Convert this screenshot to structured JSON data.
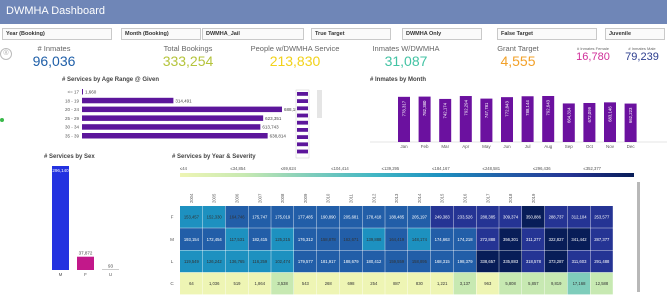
{
  "header": {
    "title": "DWMHA Dashboard"
  },
  "filters": [
    {
      "label": "Year (Booking)"
    },
    {
      "label": "Month (Booking)"
    },
    {
      "label": "DWMHA_Jail"
    },
    {
      "label": "True Target"
    },
    {
      "label": "DWMHA Only"
    },
    {
      "label": "False Target"
    },
    {
      "label": "Juvenile"
    }
  ],
  "kpis": [
    {
      "label": "# Inmates",
      "value": "96,036",
      "color": "#1f5fa8"
    },
    {
      "label": "Total Bookings",
      "value": "333,254",
      "color": "#b5c43c"
    },
    {
      "label": "People w/DWMHA Service",
      "value": "213,830",
      "color": "#f2d21a"
    },
    {
      "label": "Inmates W/DWMHA",
      "value": "31,087",
      "color": "#43c3a4"
    },
    {
      "label": "Grant Target",
      "value": "4,555",
      "color": "#f2a12a"
    },
    {
      "label": "# Inmates Female",
      "value": "16,780",
      "color": "#d02f9a"
    },
    {
      "label": "# Inmates Male",
      "value": "79,239",
      "color": "#2b3c8e"
    }
  ],
  "reg_mark": "®",
  "chart_data": [
    {
      "type": "bar",
      "orientation": "horizontal",
      "title": "# Services by Age Range @ Given",
      "categories": [
        "<= 17",
        "18 - 19",
        "20 - 24",
        "25 - 29",
        "30 - 34",
        "35 - 39"
      ],
      "values": [
        1660,
        314491,
        688185,
        623351,
        613743,
        638814
      ],
      "labels": [
        "1,660",
        "314,491",
        "688,185",
        "623,351",
        "613,743",
        "638,814"
      ],
      "color": "#5c169b"
    },
    {
      "type": "bar",
      "title": "# Inmates by Month",
      "categories": [
        "Jan",
        "Feb",
        "Mar",
        "Apr",
        "May",
        "Jun",
        "Jul",
        "Aug",
        "Sep",
        "Oct",
        "Nov",
        "Dec"
      ],
      "values": [
        778317,
        782380,
        742174,
        792294,
        747781,
        772843,
        788144,
        792643,
        664314,
        672099,
        683146,
        662223
      ],
      "labels": [
        "778,317",
        "782,380",
        "742,174",
        "792,294",
        "747,781",
        "772,843",
        "788,144",
        "792,643",
        "664,314",
        "672,099",
        "683,146",
        "662,223"
      ],
      "color": "#6b119f"
    },
    {
      "type": "bar",
      "title": "# Services by Sex",
      "categories": [
        "M",
        "F",
        "U"
      ],
      "values": [
        296140,
        37872,
        93
      ],
      "labels": [
        "296,140",
        "37,872",
        "93"
      ],
      "colors": [
        "#2332e0",
        "#c2188a",
        "#9a9a9a"
      ]
    },
    {
      "type": "heatmap",
      "title": "# Services by Year & Severity",
      "legend_ticks": [
        "≤44",
        "≤34,854",
        "≤69,624",
        "≤104,414",
        "≤139,295",
        "≤184,167",
        "≤248,581",
        "≤296,436",
        "≤352,377"
      ],
      "years": [
        "2004",
        "2005",
        "2006",
        "2007",
        "2008",
        "2009",
        "2010",
        "2011",
        "2012",
        "2013",
        "2014",
        "2015",
        "2016",
        "2017",
        "2018",
        "2019"
      ],
      "rows": [
        "F",
        "M",
        "L",
        "C"
      ],
      "values": [
        [
          153457,
          152330,
          164746,
          175747,
          175019,
          177485,
          190890,
          205681,
          178418,
          188485,
          205197,
          249383,
          233526,
          288385,
          309374,
          350886,
          288737,
          312104,
          253577,
          112054
        ],
        [
          193154,
          172454,
          117531,
          182415,
          125215,
          176312,
          158878,
          162671,
          139888,
          164419,
          148174,
          174663,
          174218,
          272888,
          356301,
          311277,
          322827,
          341442,
          287377,
          95688
        ],
        [
          119549,
          126242,
          136765,
          116259,
          102474,
          179577,
          181917,
          188679,
          180412,
          159559,
          158895,
          168315,
          198379,
          338657,
          335883,
          318578,
          373287,
          311603,
          291488,
          86873
        ],
        [
          64,
          1036,
          519,
          1864,
          3538,
          543,
          268,
          698,
          254,
          887,
          830,
          1221,
          3137,
          963,
          5808,
          5857,
          9819,
          17168,
          12588,
          6199
        ]
      ],
      "labels": [
        [
          "153,457",
          "152,330",
          "164,746",
          "175,747",
          "175,019",
          "177,485",
          "190,890",
          "205,681",
          "178,418",
          "188,485",
          "205,197",
          "249,383",
          "233,526",
          "288,385",
          "309,374",
          "350,886",
          "288,737",
          "312,104",
          "253,577",
          "112,054"
        ],
        [
          "193,154",
          "172,454",
          "117,531",
          "182,415",
          "125,215",
          "176,312",
          "158,878",
          "162,671",
          "139,888",
          "164,419",
          "148,174",
          "174,663",
          "174,218",
          "272,888",
          "356,301",
          "311,277",
          "322,827",
          "341,442",
          "287,377",
          "95,688"
        ],
        [
          "119,549",
          "126,242",
          "136,765",
          "116,259",
          "102,474",
          "179,577",
          "181,917",
          "188,679",
          "180,412",
          "159,559",
          "158,895",
          "168,315",
          "198,379",
          "338,657",
          "335,883",
          "318,578",
          "373,287",
          "311,603",
          "291,488",
          "86,873"
        ],
        [
          "64",
          "1,036",
          "519",
          "1,864",
          "3,538",
          "543",
          "268",
          "698",
          "254",
          "887",
          "830",
          "1,221",
          "3,137",
          "963",
          "5,808",
          "5,857",
          "9,819",
          "17,168",
          "12,588",
          "6,199"
        ]
      ]
    }
  ]
}
